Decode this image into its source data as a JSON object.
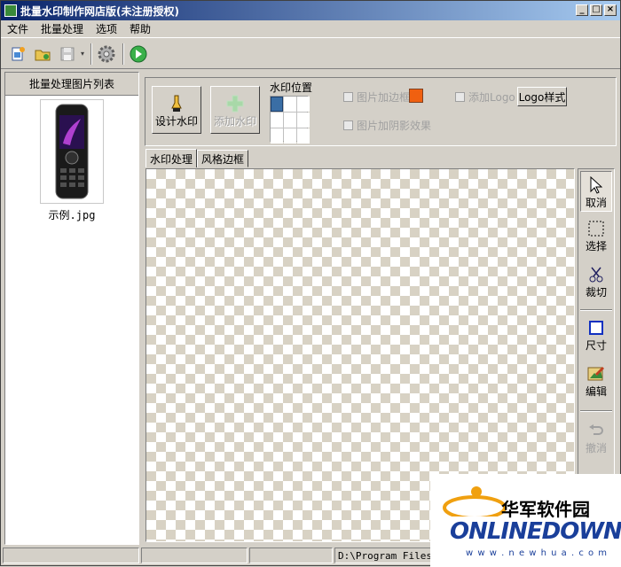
{
  "window": {
    "title": "批量水印制作网店版(未注册授权)",
    "buttons": {
      "minimize": "_",
      "maximize": "□",
      "close": "×"
    }
  },
  "menu": [
    "文件",
    "批量处理",
    "选项",
    "帮助"
  ],
  "toolbar": {
    "icons": [
      "new-file-icon",
      "open-folder-icon",
      "save-icon",
      "dropdown-arrow-icon",
      "settings-gear-icon",
      "run-arrow-icon"
    ]
  },
  "left_panel": {
    "header": "批量处理图片列表",
    "items": [
      {
        "label": "示例.jpg"
      }
    ]
  },
  "watermark_group": {
    "design_button": "设计水印",
    "add_button": "添加水印",
    "position_title": "水印位置",
    "position_selected": [
      0,
      0
    ],
    "add_border_label": "图片加边框",
    "border_color": "#f06010",
    "add_shadow_label": "图片加阴影效果",
    "add_logo_label": "添加Logo",
    "logo_style_button": "Logo样式"
  },
  "tabs": [
    {
      "label": "水印处理",
      "active": true
    },
    {
      "label": "风格边框",
      "active": false
    }
  ],
  "tools": [
    {
      "label": "取消",
      "icon": "pointer-icon"
    },
    {
      "label": "选择",
      "icon": "dashed-select-icon"
    },
    {
      "label": "裁切",
      "icon": "scissors-icon"
    },
    {
      "label": "尺寸",
      "icon": "resize-icon"
    },
    {
      "label": "编辑",
      "icon": "edit-image-icon"
    },
    {
      "label": "撤消",
      "icon": "undo-icon"
    }
  ],
  "status_bar": {
    "path": "D:\\Program Files\\批量"
  },
  "watermark_logo": {
    "cn": "华军软件园",
    "en": "ONLINEDOWN",
    "url": "w w w . n e w h u a . c o m"
  }
}
